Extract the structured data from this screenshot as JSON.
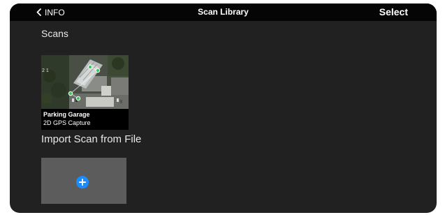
{
  "header": {
    "back_label": "INFO",
    "title": "Scan Library",
    "select_label": "Select"
  },
  "scans_section": {
    "heading": "Scans",
    "items": [
      {
        "name": "Parking Garage",
        "type": "2D GPS Capture",
        "thumbnail_corner_text": "2 1"
      }
    ]
  },
  "import_section": {
    "heading": "Import Scan from File"
  },
  "colors": {
    "topbar_bg": "#050505",
    "panel_bg": "#212121",
    "import_card_bg": "#5c5c5c",
    "accent_blue": "#1a8cff",
    "gps_marker_green": "#35c95a"
  },
  "icons": {
    "back": "chevron-left-icon",
    "add": "plus-circle-icon",
    "gps_marker": "gps-marker-icon"
  }
}
